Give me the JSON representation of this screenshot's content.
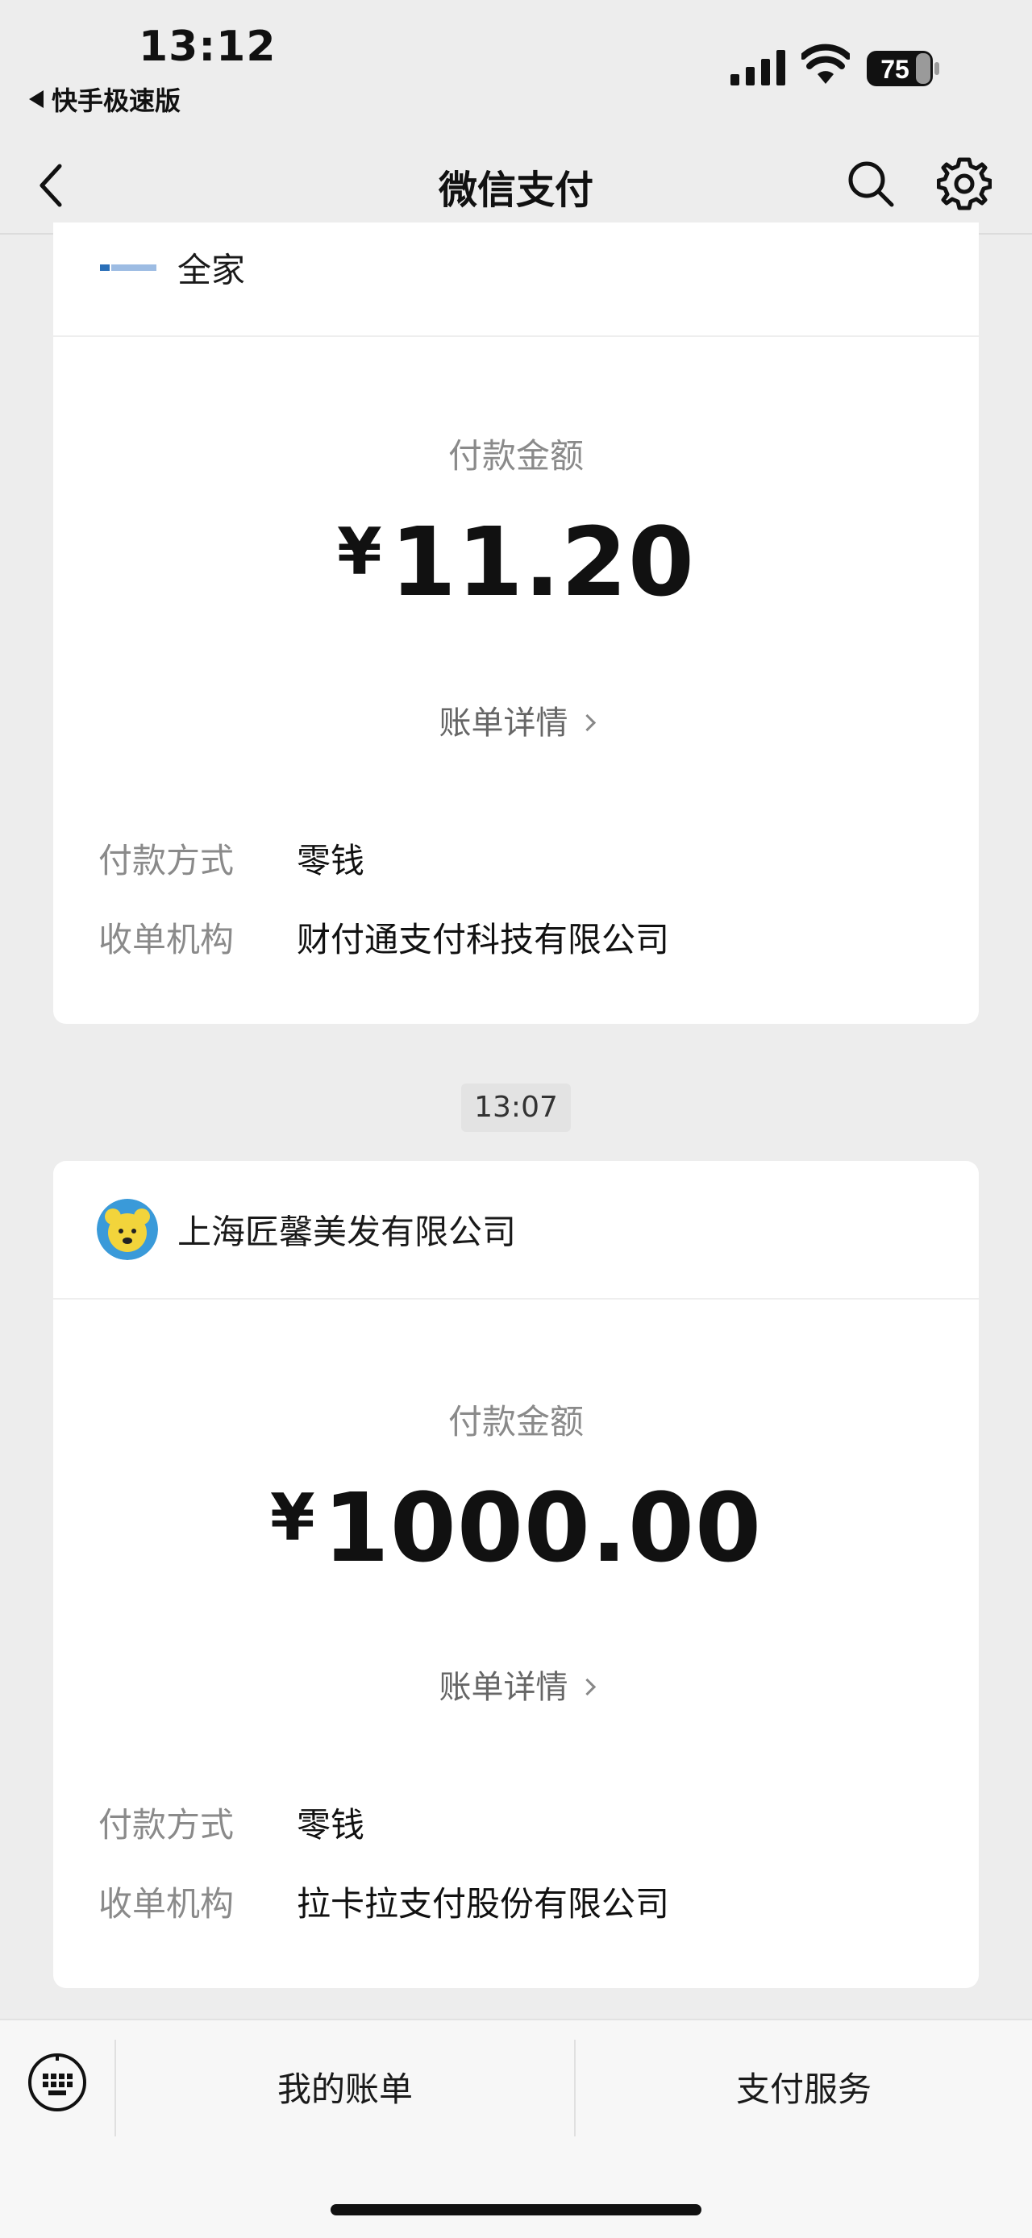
{
  "status_bar": {
    "time": "13:12",
    "back_app": "快手极速版",
    "battery": "75"
  },
  "nav": {
    "title": "微信支付",
    "back_icon": "chevron-left-icon",
    "search_icon": "search-icon",
    "settings_icon": "gear-icon"
  },
  "cards": [
    {
      "merchant": "全家",
      "amount_label": "付款金额",
      "currency": "¥",
      "amount": "11.20",
      "bill_detail": "账单详情",
      "rows": [
        {
          "key": "付款方式",
          "value": "零钱"
        },
        {
          "key": "收单机构",
          "value": "财付通支付科技有限公司"
        }
      ]
    },
    {
      "time_chip": "13:07",
      "merchant": "上海匠馨美发有限公司",
      "amount_label": "付款金额",
      "currency": "¥",
      "amount": "1000.00",
      "bill_detail": "账单详情",
      "rows": [
        {
          "key": "付款方式",
          "value": "零钱"
        },
        {
          "key": "收单机构",
          "value": "拉卡拉支付股份有限公司"
        }
      ]
    }
  ],
  "bottom_bar": {
    "keyboard_icon": "keyboard-icon",
    "tabs": [
      "我的账单",
      "支付服务"
    ]
  },
  "colors": {
    "background": "#ededed",
    "card": "#ffffff",
    "muted_text": "#8a8a8a"
  }
}
